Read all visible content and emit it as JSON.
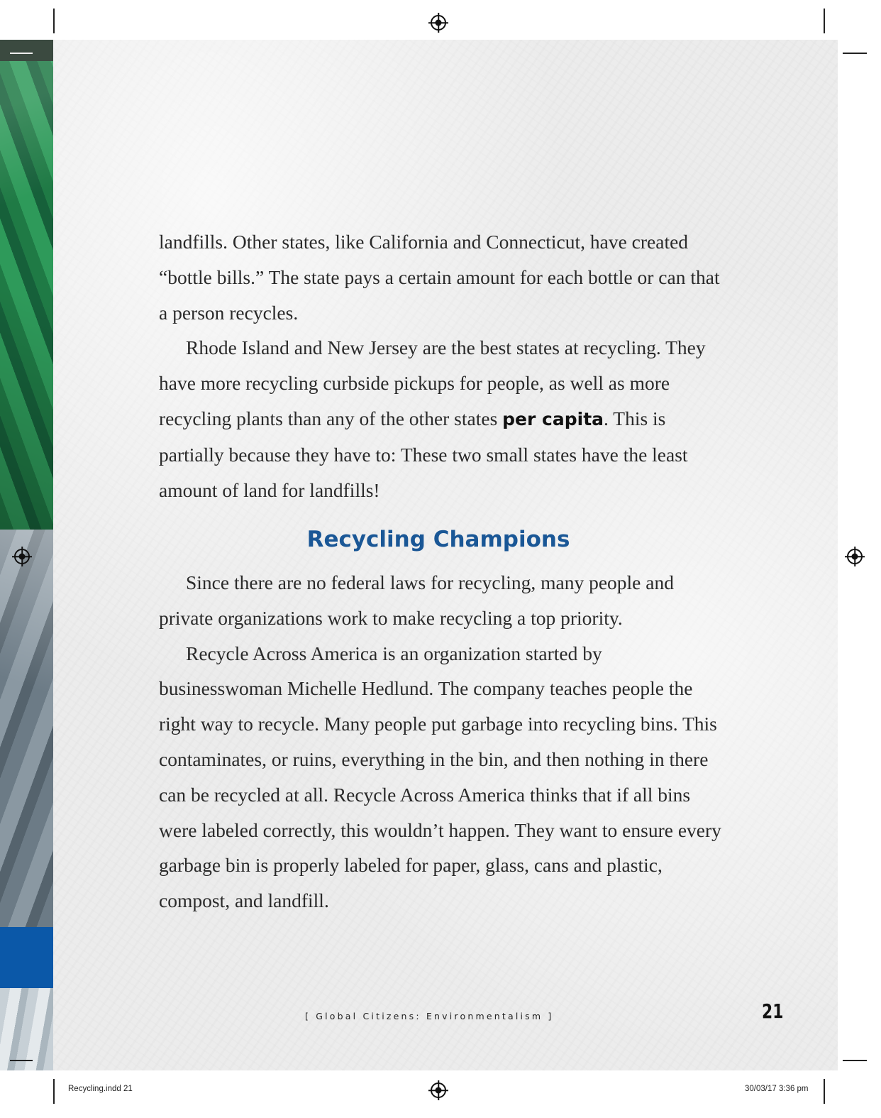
{
  "paragraphs_top": [
    "landfills. Other states, like California and Connecticut, have created “bottle bills.” The state pays a certain amount for each bottle or can that a person recycles."
  ],
  "p2": {
    "before": "Rhode Island and New Jersey are the best states at recycling. They have more recycling curbside pickups for people, as well as more recycling plants than any of the other states ",
    "keyword": "per capita",
    "after": ". This is partially because they have to: These two small states have the least amount of land for landfills!"
  },
  "heading": "Recycling Champions",
  "paragraphs_bottom": [
    "Since there are no federal laws for recycling, many people and private organizations work to make recycling a top priority.",
    "Recycle Across America is an organization started by businesswoman Michelle Hedlund. The company teaches people the right way to recycle. Many people put garbage into recycling bins. This contaminates, or ruins, everything in the bin, and then nothing in there can be recycled at all. Recycle Across America thinks that if all bins were labeled correctly, this wouldn’t happen. They want to ensure every garbage bin is properly labeled for paper, glass, cans and plastic, compost, and landfill."
  ],
  "footer": {
    "series": "[ Global Citizens: Environmentalism ]",
    "page_number": "21"
  },
  "slug": {
    "file": "Recycling.indd   21",
    "date": "30/03/17   3:36 pm"
  }
}
